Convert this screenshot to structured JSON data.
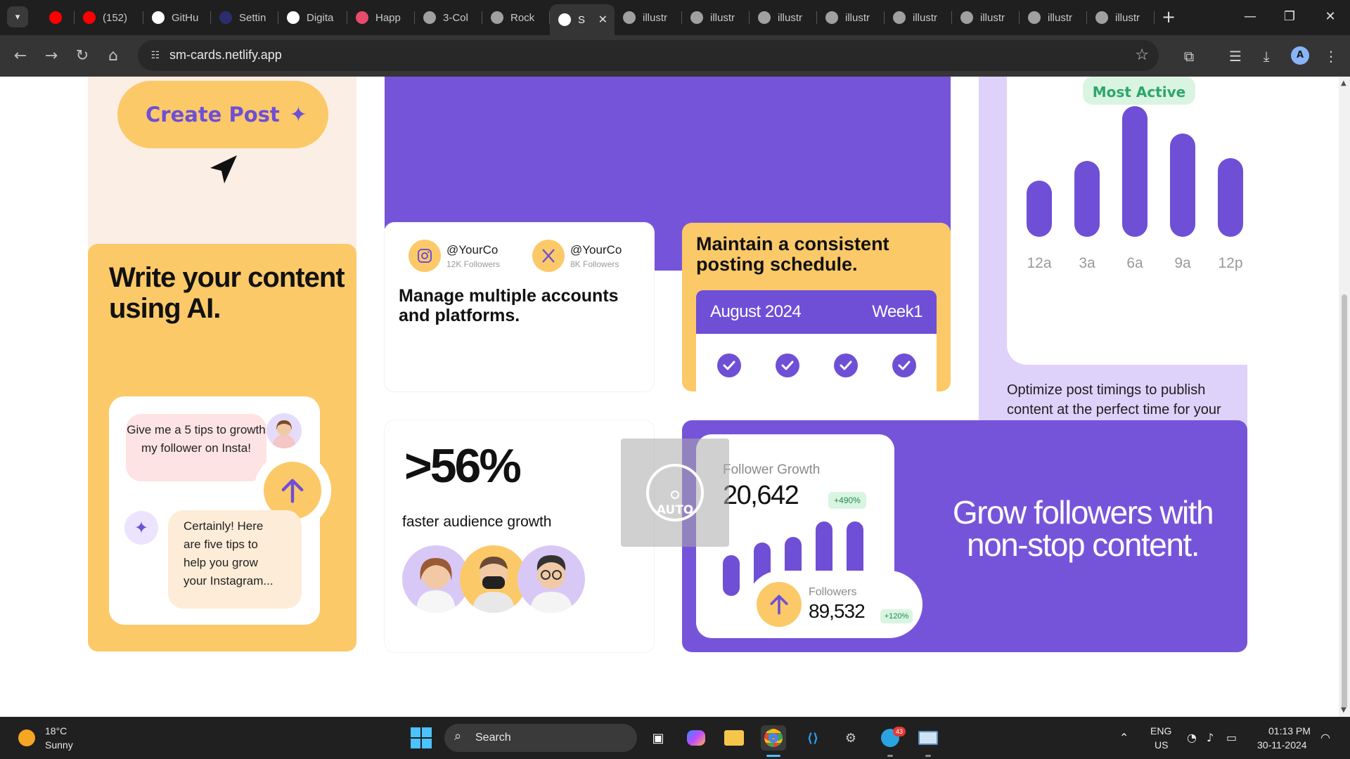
{
  "browser": {
    "tabs": [
      {
        "label": "",
        "icon": "youtube-icon",
        "color": "#ff0000"
      },
      {
        "label": "(152)",
        "icon": "youtube-icon",
        "color": "#ff0000"
      },
      {
        "label": "GitHu",
        "icon": "github-icon",
        "color": "#ffffff"
      },
      {
        "label": "Settin",
        "icon": "astro-icon",
        "color": "#2d2d6d"
      },
      {
        "label": "Digita",
        "icon": "dm-icon",
        "color": "#ffffff"
      },
      {
        "label": "Happ",
        "icon": "happy-icon",
        "color": "#e94b6d"
      },
      {
        "label": "3-Col",
        "icon": "globe-icon",
        "color": "#a0a0a0"
      },
      {
        "label": "Rock",
        "icon": "globe-icon",
        "color": "#a0a0a0"
      },
      {
        "label": "S",
        "icon": "netlify-icon",
        "color": "#ffffff",
        "active": true
      },
      {
        "label": "illustr",
        "icon": "globe-icon",
        "color": "#a0a0a0"
      },
      {
        "label": "illustr",
        "icon": "globe-icon",
        "color": "#a0a0a0"
      },
      {
        "label": "illustr",
        "icon": "globe-icon",
        "color": "#a0a0a0"
      },
      {
        "label": "illustr",
        "icon": "globe-icon",
        "color": "#a0a0a0"
      },
      {
        "label": "illustr",
        "icon": "globe-icon",
        "color": "#a0a0a0"
      },
      {
        "label": "illustr",
        "icon": "globe-icon",
        "color": "#a0a0a0"
      },
      {
        "label": "illustr",
        "icon": "globe-icon",
        "color": "#a0a0a0"
      },
      {
        "label": "illustr",
        "icon": "globe-icon",
        "color": "#a0a0a0"
      }
    ],
    "url": "sm-cards.netlify.app",
    "profile_initial": "A"
  },
  "page": {
    "colors": {
      "purple": "#7654da",
      "accent": "#6e4fd6",
      "yellow": "#fcc968",
      "peach": "#fbeee5",
      "lavender": "#ded2fa",
      "green": "#2fa56a"
    },
    "create_post": {
      "label": "Create Post"
    },
    "most_active": {
      "pill": "Most Active",
      "labels": [
        "12a",
        "3a",
        "6a",
        "9a",
        "12p"
      ],
      "activity_levels": [
        0.43,
        0.58,
        1.0,
        0.79,
        0.6
      ],
      "description": "Optimize post timings to publish content at the perfect time for your audience."
    },
    "ai": {
      "title": "Write your content using AI.",
      "user_message": "Give me a 5 tips to growth my follower on Insta!",
      "ai_message_lines": [
        "Certainly! Here",
        "are five tips to",
        "help you grow",
        "your Instagram..."
      ]
    },
    "manage": {
      "accounts": [
        {
          "handle": "@YourCo",
          "followers": "12K Followers",
          "icon": "instagram-icon"
        },
        {
          "handle": "@YourCo",
          "followers": "8K Followers",
          "icon": "x-icon"
        }
      ],
      "title": "Manage multiple accounts and platforms."
    },
    "schedule": {
      "title": "Maintain a consistent posting schedule.",
      "month": "August 2024",
      "week": "Week1"
    },
    "growth": {
      "stat": ">56%",
      "subtitle": "faster audience growth"
    },
    "followers": {
      "growth_label": "Follower Growth",
      "growth_value": "20,642",
      "growth_badge": "+490%",
      "followers_label": "Followers",
      "followers_value": "89,532",
      "followers_badge": "+120%",
      "title": "Grow followers with non-stop content."
    },
    "overlay": {
      "label": "AUTO"
    }
  },
  "taskbar": {
    "weather_temp": "18°C",
    "weather_condition": "Sunny",
    "search_label": "Search",
    "lang_1": "ENG",
    "lang_2": "US",
    "time": "01:13 PM",
    "date": "30-11-2024",
    "telegram_badge": "43"
  }
}
